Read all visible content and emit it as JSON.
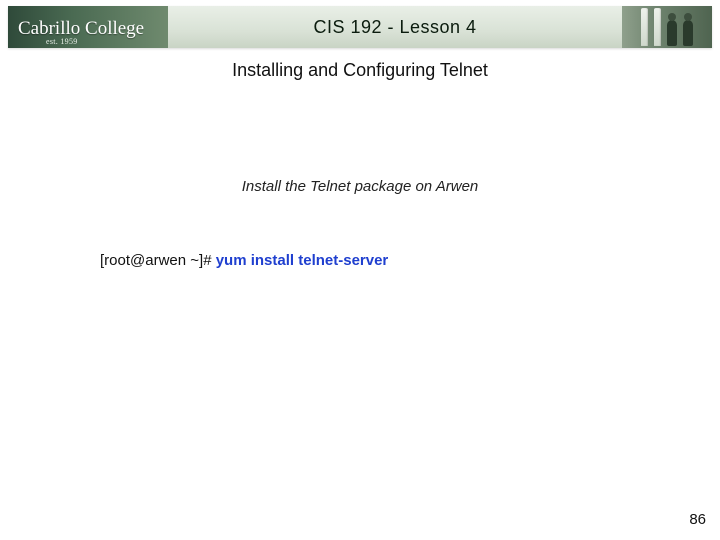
{
  "banner": {
    "logo_script": "Cabrillo College",
    "logo_est": "est. 1959",
    "title": "CIS 192 - Lesson 4"
  },
  "subtitle": "Installing and Configuring Telnet",
  "instruction": "Install the Telnet package on Arwen",
  "terminal": {
    "prompt": "[root@arwen ~]# ",
    "command": "yum install telnet-server"
  },
  "page_number": "86"
}
